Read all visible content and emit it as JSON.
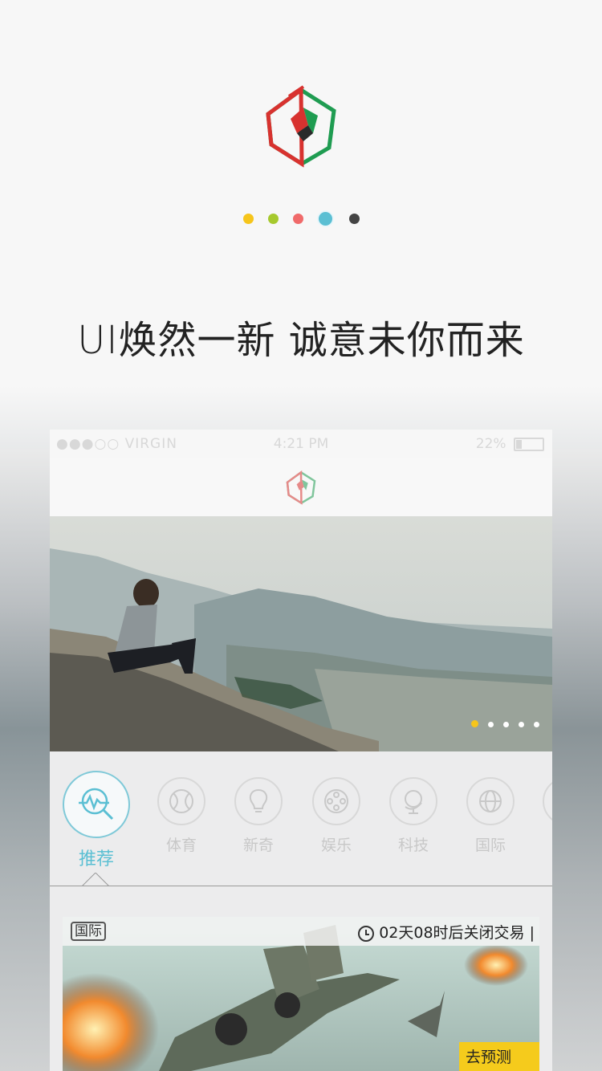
{
  "headline": "UI焕然一新   诚意未你而来",
  "pager": {
    "dot_colors": [
      "#f6c51b",
      "#a6c92e",
      "#f06a6a",
      "#5bbfd3",
      "#444444"
    ],
    "active_index": 3
  },
  "phone": {
    "status": {
      "carrier": "●●●○○ VIRGIN",
      "time": "4:21 PM",
      "battery": "22%"
    },
    "banner_pages": 5,
    "banner_active": 0,
    "categories": [
      {
        "label": "推荐",
        "icon": "search-chart-icon"
      },
      {
        "label": "体育",
        "icon": "tennis-ball-icon"
      },
      {
        "label": "新奇",
        "icon": "lightbulb-icon"
      },
      {
        "label": "娱乐",
        "icon": "film-reel-icon"
      },
      {
        "label": "科技",
        "icon": "globe-stand-icon"
      },
      {
        "label": "国际",
        "icon": "world-icon"
      }
    ],
    "card": {
      "tag": "国际",
      "countdown": "02天08时后关闭交易 |",
      "action": "去预测"
    }
  },
  "colors": {
    "accent": "#5bbfd3",
    "brand_red": "#d8322f",
    "brand_green": "#1f9c51",
    "predict": "#f5cb1c"
  }
}
